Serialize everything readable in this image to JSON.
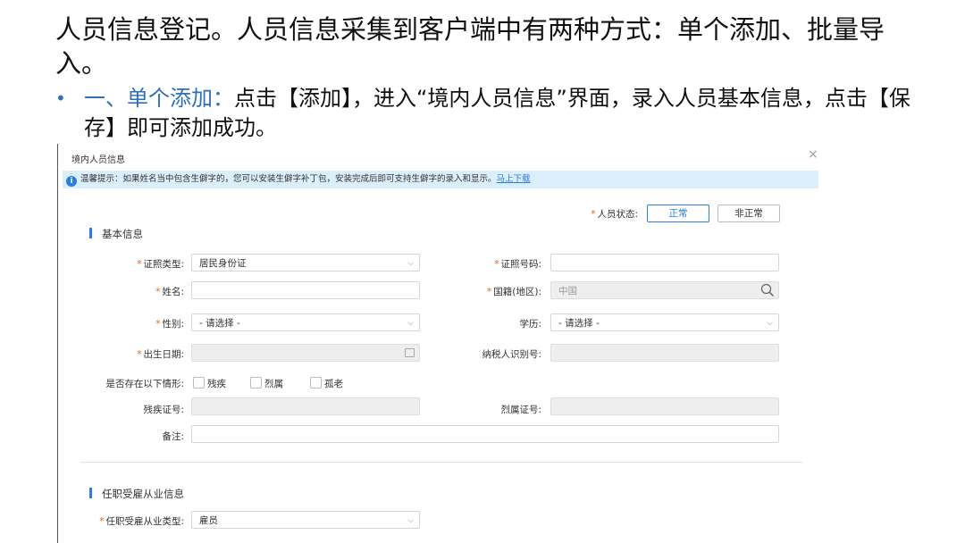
{
  "slide": {
    "title": "人员信息登记。人员信息采集到客户端中有两种方式：单个添加、批量导入。",
    "bullet_marker": "•",
    "bullet_lead": "一、单个添加：",
    "bullet_rest": "点击【添加】，进入“境内人员信息”界面，录入人员基本信息，点击【保存】即可添加成功。"
  },
  "dialog": {
    "title": "境内人员信息",
    "close_glyph": "×",
    "tip_icon": "i",
    "tip_text": "温馨提示：如果姓名当中包含生僻字的，您可以安装生僻字补丁包，安装完成后即可支持生僻字的录入和显示。",
    "tip_link": "马上下载"
  },
  "status": {
    "label": "人员状态:",
    "options": [
      "正常",
      "非正常"
    ],
    "selected": "正常"
  },
  "basic_section": {
    "title": "基本信息",
    "id_type": {
      "label": "证照类型:",
      "value": "居民身份证"
    },
    "id_number": {
      "label": "证照号码:",
      "value": ""
    },
    "name": {
      "label": "姓名:",
      "value": ""
    },
    "nationality": {
      "label": "国籍(地区):",
      "value": "中国"
    },
    "gender": {
      "label": "性别:",
      "value": "- 请选择 -"
    },
    "education": {
      "label": "学历:",
      "value": "- 请选择 -"
    },
    "birth_date": {
      "label": "出生日期:",
      "value": ""
    },
    "taxpayer_id": {
      "label": "纳税人识别号:",
      "value": ""
    },
    "situation": {
      "label": "是否存在以下情形:",
      "options": [
        "残疾",
        "烈属",
        "孤老"
      ]
    },
    "disability_no": {
      "label": "残疾证号:",
      "value": ""
    },
    "martyr_no": {
      "label": "烈属证号:",
      "value": ""
    },
    "remark": {
      "label": "备注:",
      "value": ""
    }
  },
  "employment_section": {
    "title": "任职受雇从业信息",
    "type": {
      "label": "任职受雇从业类型:",
      "value": "雇员"
    }
  },
  "colors": {
    "accent": "#2b7de3",
    "required": "#e8631a",
    "tip_bg": "#dbeefb",
    "slide_accent": "#2f6fb3"
  },
  "icons": [
    "close-icon",
    "info-icon",
    "chevron-down-icon",
    "search-icon",
    "calendar-icon"
  ]
}
